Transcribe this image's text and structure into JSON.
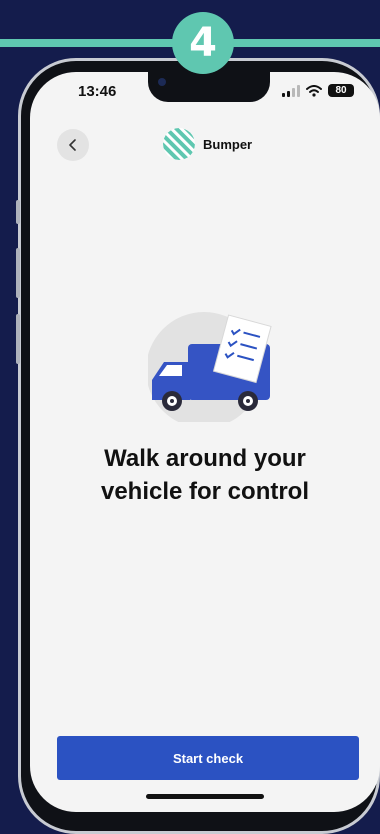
{
  "step_badge": "4",
  "status_bar": {
    "time": "13:46",
    "battery": "80"
  },
  "header": {
    "brand": "Bumper"
  },
  "main": {
    "title_line1": "Walk around your",
    "title_line2": "vehicle for control"
  },
  "footer": {
    "start_label": "Start check"
  },
  "colors": {
    "accent": "#5fc7b0",
    "primary": "#2b52c2",
    "background": "#141c4c",
    "screen": "#f4f4f4"
  },
  "icons": {
    "back": "chevron-left-icon",
    "logo": "striped-circle-logo",
    "illustration": "truck-checklist-illustration"
  }
}
